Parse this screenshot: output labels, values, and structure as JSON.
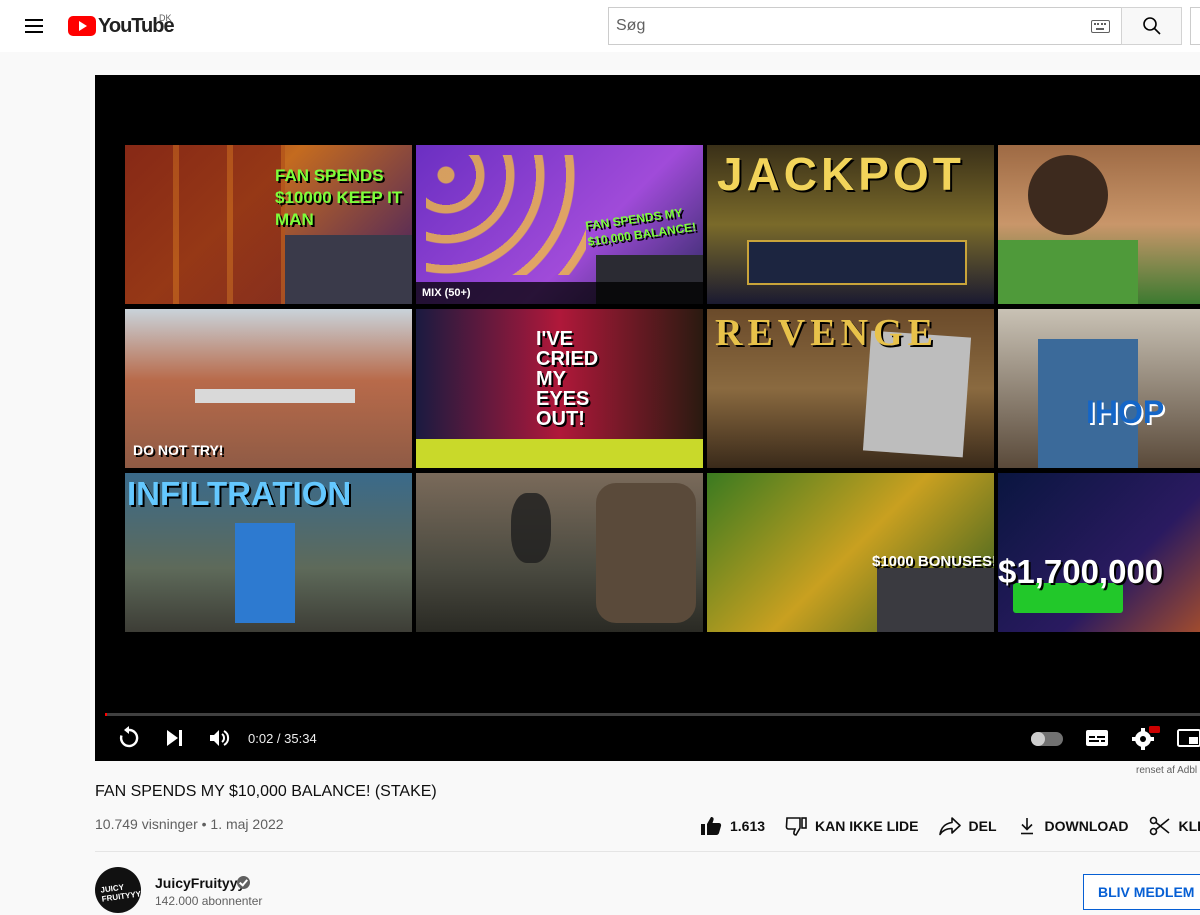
{
  "masthead": {
    "logo_text": "YouTube",
    "region": "DK",
    "search_placeholder": "Søg"
  },
  "player": {
    "time": "0:02 / 35:34",
    "progress_fraction": 0.0009,
    "removed_note": "renset af Adbl",
    "endscreen_tiles": [
      {
        "overlay": "FAN SPENDS $10000 KEEP IT MAN",
        "badge": ""
      },
      {
        "overlay": "FAN SPENDS MY $10,000 BALANCE!",
        "badge": "MIX (50+)"
      },
      {
        "overlay": "JACKPOT",
        "badge": ""
      },
      {
        "overlay": "",
        "badge": ""
      },
      {
        "overlay": "DO NOT TRY!",
        "badge": ""
      },
      {
        "overlay": "I'VE CRIED MY EYES OUT!",
        "badge": ""
      },
      {
        "overlay": "REVENGE",
        "badge": ""
      },
      {
        "overlay": "IHOP",
        "badge": ""
      },
      {
        "overlay": "INFILTRATION",
        "badge": ""
      },
      {
        "overlay": "",
        "badge": ""
      },
      {
        "overlay": "$1000 BONUSES!",
        "badge": ""
      },
      {
        "overlay": "$1,700,000",
        "badge": ""
      }
    ]
  },
  "video": {
    "title": "FAN SPENDS MY $10,000 BALANCE! (STAKE)",
    "meta": "10.749 visninger • 1. maj 2022",
    "likes": "1.613",
    "dislike_label": "KAN IKKE LIDE",
    "share_label": "DEL",
    "download_label": "DOWNLOAD",
    "clip_label": "KLIP"
  },
  "channel": {
    "name": "JuicyFruityyy",
    "avatar_text": "JUICY FRUITYYY",
    "subscribers": "142.000 abonnenter",
    "join_label": "BLIV MEDLEM"
  },
  "colors": {
    "brand_red": "#ff0000",
    "link_blue": "#065fd4"
  }
}
